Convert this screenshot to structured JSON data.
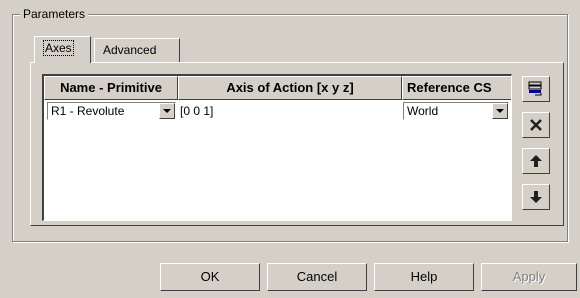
{
  "groupbox": {
    "title": "Parameters"
  },
  "tabs": [
    {
      "label": "Axes",
      "active": true
    },
    {
      "label": "Advanced",
      "active": false
    }
  ],
  "grid": {
    "columns": [
      "Name - Primitive",
      "Axis of Action [x y z]",
      "Reference CS"
    ],
    "rows": [
      {
        "name_primitive": "R1 - Revolute",
        "axis": "[0 0 1]",
        "reference_cs": "World"
      }
    ]
  },
  "side_buttons": [
    {
      "icon": "add-row-icon"
    },
    {
      "icon": "delete-icon"
    },
    {
      "icon": "move-up-icon"
    },
    {
      "icon": "move-down-icon"
    }
  ],
  "buttons": {
    "ok": "OK",
    "cancel": "Cancel",
    "help": "Help",
    "apply": "Apply"
  },
  "colors": {
    "face": "#d4d0c8",
    "disabled_text": "#808080"
  }
}
